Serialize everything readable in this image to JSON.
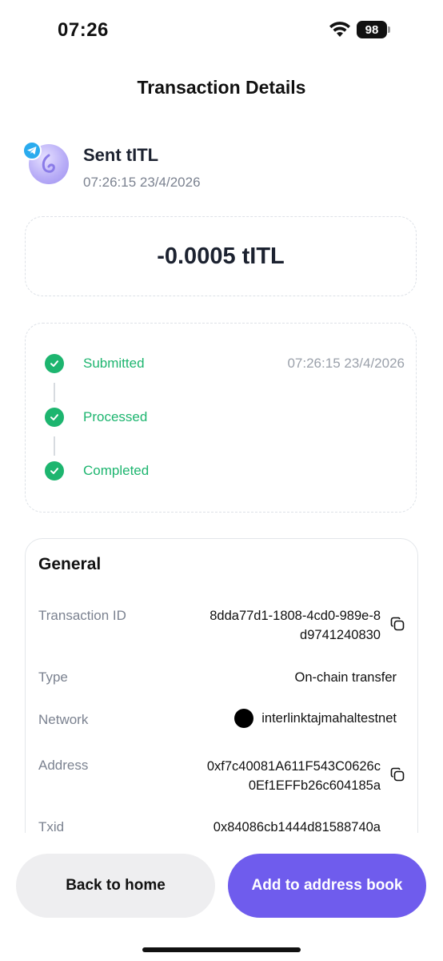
{
  "status_bar": {
    "time": "07:26",
    "battery": "98"
  },
  "header": {
    "title": "Transaction Details"
  },
  "transaction": {
    "title": "Sent tITL",
    "timestamp": "07:26:15 23/4/2026",
    "amount": "-0.0005 tITL"
  },
  "timeline": {
    "steps": [
      {
        "label": "Submitted",
        "time": "07:26:15 23/4/2026"
      },
      {
        "label": "Processed",
        "time": ""
      },
      {
        "label": "Completed",
        "time": ""
      }
    ]
  },
  "general": {
    "title": "General",
    "rows": {
      "transaction_id": {
        "label": "Transaction ID",
        "value_line1": "8dda77d1-1808-4cd0-989e-8",
        "value_line2": "d9741240830"
      },
      "type": {
        "label": "Type",
        "value": "On-chain transfer"
      },
      "network": {
        "label": "Network",
        "value": "interlinktajmahaltestnet"
      },
      "address": {
        "label": "Address",
        "value_line1": "0xf7c40081A611F543C0626c",
        "value_line2": "0Ef1EFFb26c604185a"
      },
      "txid": {
        "label": "Txid",
        "value_line1": "0x84086cb1444d81588740a"
      }
    }
  },
  "actions": {
    "back_label": "Back to home",
    "add_label": "Add to address book"
  },
  "colors": {
    "success": "#1db56f",
    "primary": "#6f5ced",
    "telegram": "#2aabee"
  }
}
